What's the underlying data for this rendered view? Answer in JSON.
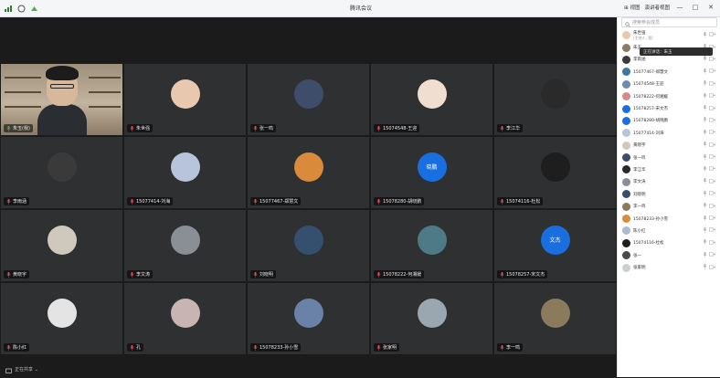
{
  "window": {
    "title": "腾讯会议"
  },
  "toolbar": {
    "layout_label": "⊞ 视图",
    "view_label": "演讲者视图",
    "controls": [
      "—",
      "□",
      "✕"
    ]
  },
  "tooltip": {
    "text": "正在讲话：朱玉"
  },
  "search": {
    "placeholder": "搜索参会成员"
  },
  "tiles": [
    {
      "name": "朱玉(我)",
      "type": "video"
    },
    {
      "name": "朱世强",
      "type": "avatar",
      "color": "#e8c9b0"
    },
    {
      "name": "张一鸣",
      "type": "avatar",
      "color": "#3d4d6a"
    },
    {
      "name": "15074548-王迎",
      "type": "avatar",
      "color": "#f0dfd0"
    },
    {
      "name": "李江华",
      "type": "avatar",
      "color": "#2a2a2a"
    },
    {
      "name": "李雨涵",
      "type": "avatar",
      "color": "#3a3a3a"
    },
    {
      "name": "15077414-刘海",
      "type": "avatar",
      "color": "#b8c4dc"
    },
    {
      "name": "15077467-郑慧文",
      "type": "avatar",
      "color": "#d98a3a"
    },
    {
      "name": "15078280-胡晓鹏",
      "type": "text",
      "color": "#1a6fe0",
      "text": "晓鹏"
    },
    {
      "name": "15074116-杜松",
      "type": "avatar",
      "color": "#1e1e1e"
    },
    {
      "name": "黄晓宇",
      "type": "avatar",
      "color": "#cfc8bd"
    },
    {
      "name": "李文涛",
      "type": "avatar",
      "color": "#8a8f96"
    },
    {
      "name": "刘晓明",
      "type": "avatar",
      "color": "#35506e"
    },
    {
      "name": "15078222-何湘媛",
      "type": "avatar",
      "color": "#4d7a86"
    },
    {
      "name": "15078257-宋文杰",
      "type": "text",
      "color": "#1a6fe0",
      "text": "文杰"
    },
    {
      "name": "陈小红",
      "type": "avatar",
      "color": "#e4e4e4"
    },
    {
      "name": "孔",
      "type": "avatar",
      "color": "#c9b4b4"
    },
    {
      "name": "15078233-孙小雪",
      "type": "avatar",
      "color": "#6b82a8"
    },
    {
      "name": "张家明",
      "type": "avatar",
      "color": "#9aa6b0"
    },
    {
      "name": "李一鸣",
      "type": "avatar",
      "color": "#8a7b5c"
    }
  ],
  "participants": [
    {
      "name": "朱世强",
      "sub": "(主持人, 我)",
      "color": "#e8c9b0"
    },
    {
      "name": "朱玉",
      "sub": "",
      "color": "#8a7a66"
    },
    {
      "name": "李雨涵",
      "sub": "",
      "color": "#3a3a3a"
    },
    {
      "name": "15077467-郑慧文",
      "sub": "",
      "color": "#3b79a3"
    },
    {
      "name": "15074548-王迎",
      "sub": "",
      "color": "#6c8db0"
    },
    {
      "name": "15078222-何湘媛",
      "sub": "",
      "color": "#d88a8a"
    },
    {
      "name": "15078257-宋文杰",
      "sub": "",
      "color": "#1a6fe0"
    },
    {
      "name": "15078280-胡晓鹏",
      "sub": "",
      "color": "#1a6fe0"
    },
    {
      "name": "15077414-刘海",
      "sub": "",
      "color": "#b8c4dc"
    },
    {
      "name": "黄晓宇",
      "sub": "",
      "color": "#cfc8bd"
    },
    {
      "name": "张一鸣",
      "sub": "",
      "color": "#3d4d6a"
    },
    {
      "name": "李江华",
      "sub": "",
      "color": "#2a2a2a"
    },
    {
      "name": "李文涛",
      "sub": "",
      "color": "#8a8f96"
    },
    {
      "name": "刘晓明",
      "sub": "",
      "color": "#35506e"
    },
    {
      "name": "李一鸣",
      "sub": "",
      "color": "#8a7b5c"
    },
    {
      "name": "15078233-孙小雪",
      "sub": "",
      "color": "#d98a3a"
    },
    {
      "name": "陈小红",
      "sub": "",
      "color": "#a9bbd2"
    },
    {
      "name": "15074116-杜松",
      "sub": "",
      "color": "#1e1e1e"
    },
    {
      "name": "张一",
      "sub": "",
      "color": "#4a4a4a"
    },
    {
      "name": "张家明",
      "sub": "",
      "color": "#c9cfd6"
    }
  ],
  "bottom": {
    "label": "正在共享 ⌄"
  }
}
